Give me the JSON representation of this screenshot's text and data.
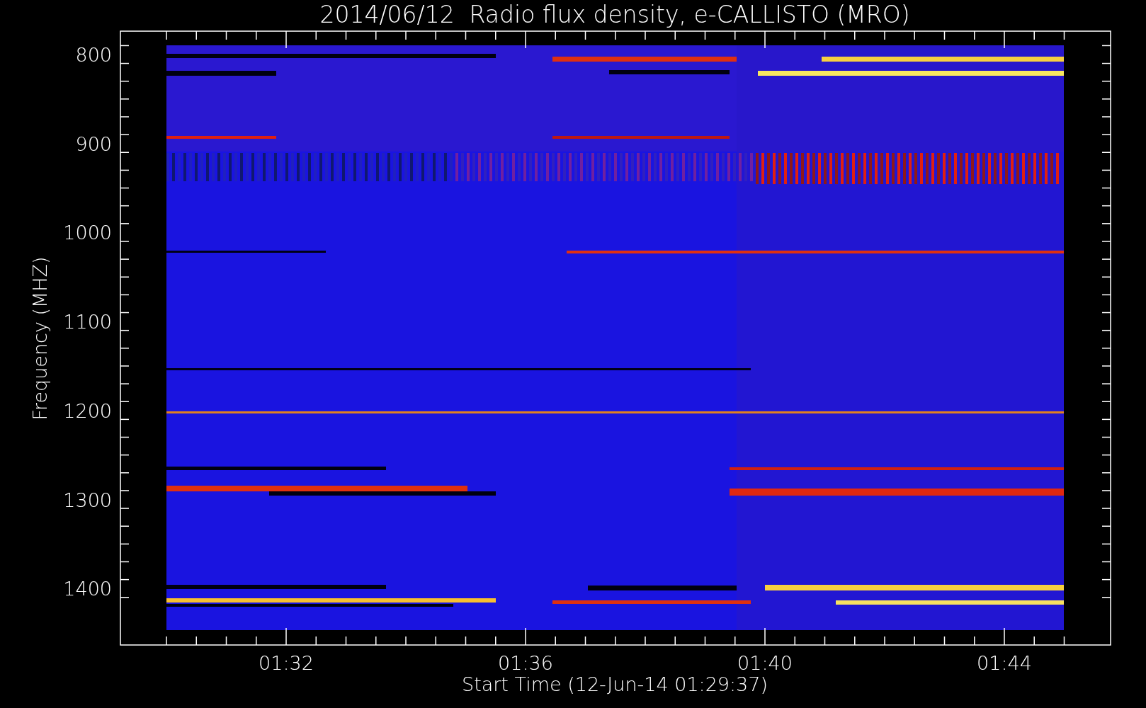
{
  "title": "2014/06/12  Radio flux density, e-CALLISTO (MRO)",
  "y_axis": {
    "title": "Frequency (MHZ)",
    "tick_labels": [
      "800",
      "900",
      "1000",
      "1100",
      "1200",
      "1300",
      "1400"
    ]
  },
  "x_axis": {
    "title": "Start Time (12-Jun-14 01:29:37)",
    "tick_labels": [
      "01:32",
      "01:36",
      "01:40",
      "01:44"
    ]
  }
}
